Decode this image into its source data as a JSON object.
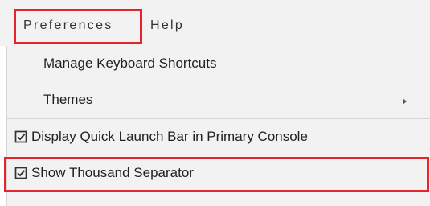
{
  "menu": {
    "preferences": "Preferences",
    "help": "Help"
  },
  "dropdown": {
    "items": [
      {
        "label": "Manage Keyboard Shortcuts"
      },
      {
        "label": "Themes",
        "submenu_icon": "chevron-right-icon"
      },
      {
        "label": "Display Quick Launch Bar in Primary Console",
        "checked": true,
        "icon": "checkbox-checked-icon"
      },
      {
        "label": "Show Thousand Separator",
        "checked": true,
        "icon": "checkbox-checked-icon"
      }
    ]
  },
  "colors": {
    "highlight": "#e5242b",
    "menu_background": "#f2f2f2"
  }
}
